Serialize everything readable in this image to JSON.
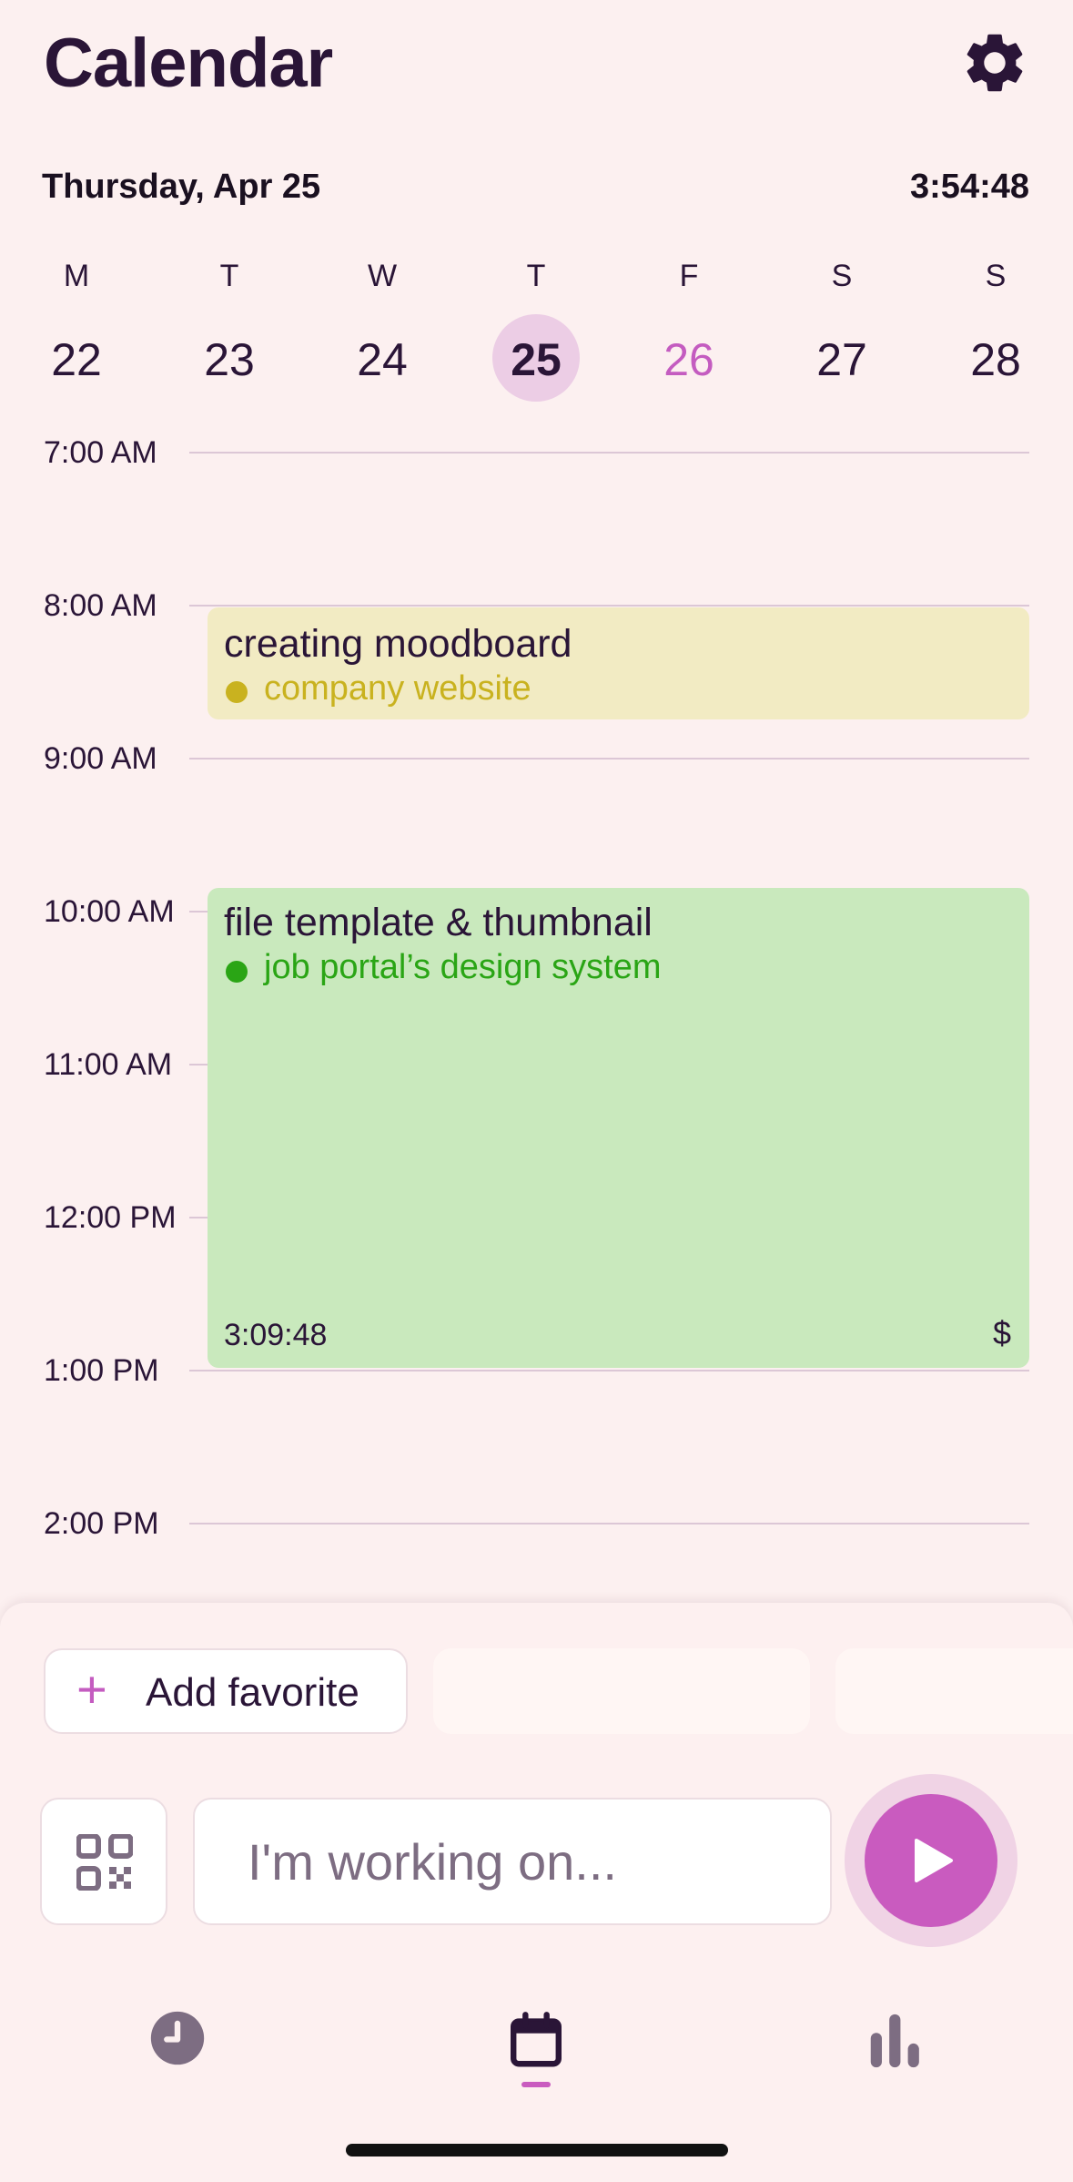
{
  "header": {
    "title": "Calendar"
  },
  "date_bar": {
    "date": "Thursday, Apr 25",
    "clock": "3:54:48"
  },
  "week": {
    "days": [
      {
        "weekday": "M",
        "day": "22"
      },
      {
        "weekday": "T",
        "day": "23"
      },
      {
        "weekday": "W",
        "day": "24"
      },
      {
        "weekday": "T",
        "day": "25"
      },
      {
        "weekday": "F",
        "day": "26"
      },
      {
        "weekday": "S",
        "day": "27"
      },
      {
        "weekday": "S",
        "day": "28"
      }
    ]
  },
  "timeline": {
    "hours": [
      "7:00 AM",
      "8:00 AM",
      "9:00 AM",
      "10:00 AM",
      "11:00 AM",
      "12:00 PM",
      "1:00 PM",
      "2:00 PM"
    ]
  },
  "events": [
    {
      "title": "creating moodboard",
      "project": "company website",
      "color": "#f2ebc3",
      "project_color": "#c9b21f"
    },
    {
      "title": "file template & thumbnail",
      "project": "job portal’s design system",
      "color": "#c9e9bd",
      "project_color": "#2aa515",
      "duration": "3:09:48",
      "money_symbol": "$"
    }
  ],
  "favorites": {
    "add_label": "Add favorite"
  },
  "tracker": {
    "placeholder": "I'm working on..."
  },
  "colors": {
    "accent": "#c95bbf",
    "background": "#fcf0f0",
    "text": "#2a1537"
  },
  "icons": {
    "settings": "gear-icon",
    "add": "plus-icon",
    "scan": "qr-code-icon",
    "start": "play-icon",
    "nav_history": "clock-icon",
    "nav_calendar": "calendar-icon",
    "nav_stats": "bar-chart-icon"
  }
}
